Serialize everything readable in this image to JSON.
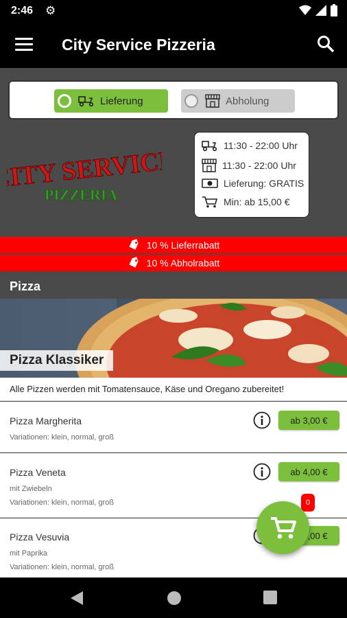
{
  "status": {
    "time": "2:46"
  },
  "app": {
    "title": "City Service Pizzeria"
  },
  "mode": {
    "delivery_label": "Lieferung",
    "pickup_label": "Abholung"
  },
  "logo": {
    "top": "CITY SERVICE",
    "bottom": "PIZZERIA"
  },
  "info": {
    "delivery_hours": "11:30 - 22:00 Uhr",
    "pickup_hours": "11:30 - 22:00 Uhr",
    "delivery_fee": "Lieferung: GRATIS",
    "minimum": "Min: ab 15,00 €"
  },
  "banners": {
    "delivery_discount": "10 % Lieferrabatt",
    "pickup_discount": "10 % Abholrabatt"
  },
  "section": {
    "title": "Pizza"
  },
  "category": {
    "name": "Pizza Klassiker",
    "description": "Alle Pizzen werden mit Tomatensauce, Käse und Oregano zubereitet!"
  },
  "items": [
    {
      "name": "Pizza Margherita",
      "extra": "",
      "variations": "Variationen: klein, normal, groß",
      "price": "ab 3,00 €"
    },
    {
      "name": "Pizza Veneta",
      "extra": "mit Zwiebeln",
      "variations": "Variationen: klein, normal, groß",
      "price": "ab 4,00 €"
    },
    {
      "name": "Pizza Vesuvia",
      "extra": "mit Paprika",
      "variations": "Variationen: klein, normal, groß",
      "price": "ab 4,00 €"
    }
  ],
  "cart": {
    "count": "0"
  },
  "colors": {
    "accent": "#7cbf3c",
    "banner": "#ff0000",
    "bar": "#000000",
    "background": "#4a4a4a"
  }
}
